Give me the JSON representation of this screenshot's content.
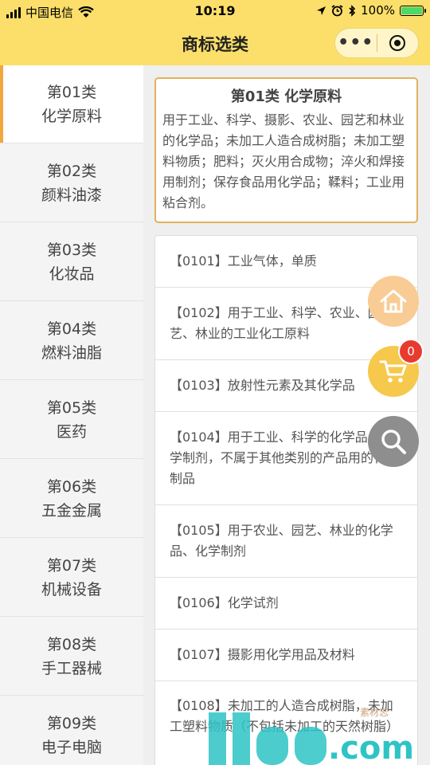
{
  "status_bar": {
    "carrier": "中国电信",
    "time": "10:19",
    "battery": "100%"
  },
  "nav": {
    "title": "商标选类",
    "more_icon": "more-dots-icon",
    "close_icon": "target-close-icon"
  },
  "sidebar": {
    "items": [
      {
        "num": "第01类",
        "name": "化学原料"
      },
      {
        "num": "第02类",
        "name": "颜料油漆"
      },
      {
        "num": "第03类",
        "name": "化妆品"
      },
      {
        "num": "第04类",
        "name": "燃料油脂"
      },
      {
        "num": "第05类",
        "name": "医药"
      },
      {
        "num": "第06类",
        "name": "五金金属"
      },
      {
        "num": "第07类",
        "name": "机械设备"
      },
      {
        "num": "第08类",
        "name": "手工器械"
      },
      {
        "num": "第09类",
        "name": "电子电脑"
      }
    ]
  },
  "category": {
    "title": "第01类 化学原料",
    "description": "用于工业、科学、摄影、农业、园艺和林业的化学品；未加工人造合成树脂；未加工塑料物质；肥料；灭火用合成物；淬火和焊接用制剂；保存食品用化学品；鞣料；工业用粘合剂。"
  },
  "subgroups": [
    "【0101】工业气体，单质",
    "【0102】用于工业、科学、农业、园艺、林业的工业化工原料",
    "【0103】放射性元素及其化学品",
    "【0104】用于工业、科学的化学品、化学制剂，不属于其他类别的产品用的化学制品",
    "【0105】用于农业、园艺、林业的化学品、化学制剂",
    "【0106】化学试剂",
    "【0107】摄影用化学用品及材料",
    "【0108】未加工的人造合成树脂，未加工塑料物质（不包括未加工的天然树脂）"
  ],
  "floating": {
    "cart_count": "0"
  },
  "watermark": {
    "text": ".com",
    "caption": "素材志"
  },
  "colors": {
    "nav_bg": "#fbdf6a",
    "active_bar": "#f2a63d",
    "card_border": "#e3b15d",
    "badge": "#e83b2f"
  }
}
